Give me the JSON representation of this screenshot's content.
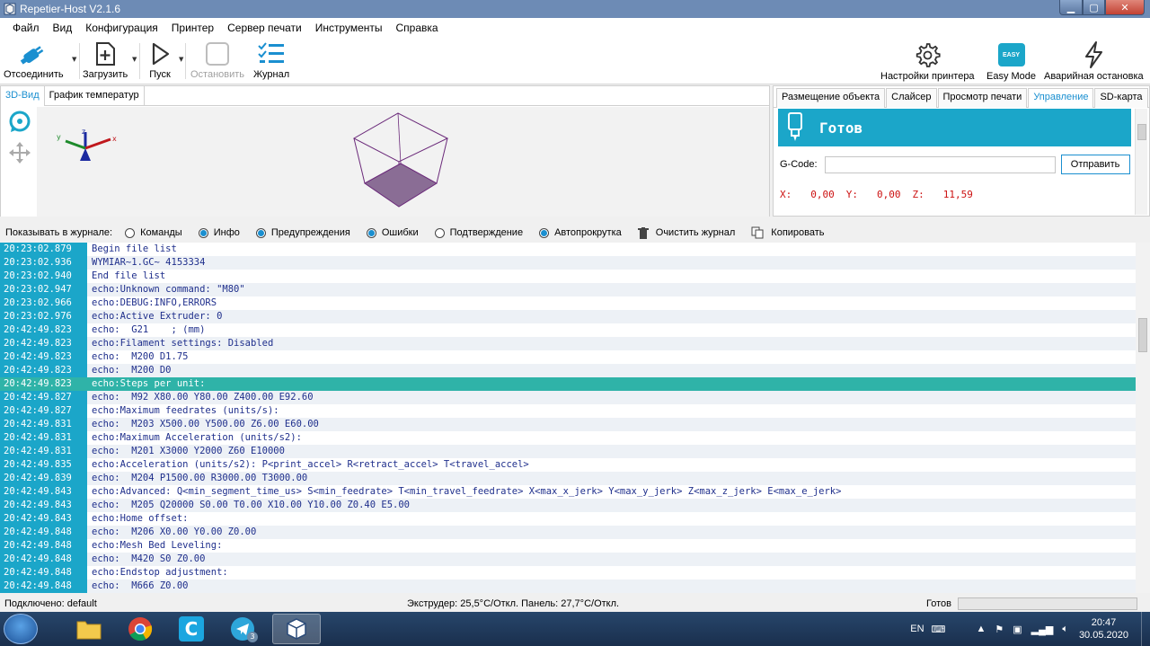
{
  "window": {
    "title": "Repetier-Host V2.1.6"
  },
  "menu": [
    "Файл",
    "Вид",
    "Конфигурация",
    "Принтер",
    "Сервер печати",
    "Инструменты",
    "Справка"
  ],
  "toolbar": {
    "disconnect": "Отсоединить",
    "load": "Загрузить",
    "run": "Пуск",
    "stop": "Остановить",
    "log": "Журнал",
    "printer_settings": "Настройки принтера",
    "easy_mode": "Easy Mode",
    "easy_badge": "EASY",
    "emergency_stop": "Аварийная остановка"
  },
  "viewer_tabs": [
    "3D-Вид",
    "График температур"
  ],
  "right_tabs": [
    "Размещение объекта",
    "Слайсер",
    "Просмотр печати",
    "Управление",
    "SD-карта"
  ],
  "control": {
    "status": "Готов",
    "gcode_label": "G-Code:",
    "gcode_value": "",
    "send_button": "Отправить",
    "coords": {
      "x_label": "X:",
      "x": "0,00",
      "y_label": "Y:",
      "y": "0,00",
      "z_label": "Z:",
      "z": "11,59"
    }
  },
  "log_options": {
    "label": "Показывать в журнале:",
    "commands": "Команды",
    "info": "Инфо",
    "warnings": "Предупреждения",
    "errors": "Ошибки",
    "ack": "Подтверждение",
    "autoscroll": "Автопрокрутка",
    "clear": "Очистить журнал",
    "copy": "Копировать",
    "state": {
      "commands": false,
      "info": true,
      "warnings": true,
      "errors": true,
      "ack": false,
      "autoscroll": true
    }
  },
  "log": [
    {
      "time": "20:23:02.879",
      "msg": "Begin file list"
    },
    {
      "time": "20:23:02.936",
      "msg": "WYMIAR~1.GC~ 4153334"
    },
    {
      "time": "20:23:02.940",
      "msg": "End file list"
    },
    {
      "time": "20:23:02.947",
      "msg": "echo:Unknown command: \"M80\""
    },
    {
      "time": "20:23:02.966",
      "msg": "echo:DEBUG:INFO,ERRORS"
    },
    {
      "time": "20:23:02.976",
      "msg": "echo:Active Extruder: 0"
    },
    {
      "time": "20:42:49.823",
      "msg": "echo:  G21    ; (mm)"
    },
    {
      "time": "20:42:49.823",
      "msg": "echo:Filament settings: Disabled"
    },
    {
      "time": "20:42:49.823",
      "msg": "echo:  M200 D1.75"
    },
    {
      "time": "20:42:49.823",
      "msg": "echo:  M200 D0"
    },
    {
      "time": "20:42:49.823",
      "msg": "echo:Steps per unit:",
      "selected": true
    },
    {
      "time": "20:42:49.827",
      "msg": "echo:  M92 X80.00 Y80.00 Z400.00 E92.60"
    },
    {
      "time": "20:42:49.827",
      "msg": "echo:Maximum feedrates (units/s):"
    },
    {
      "time": "20:42:49.831",
      "msg": "echo:  M203 X500.00 Y500.00 Z6.00 E60.00"
    },
    {
      "time": "20:42:49.831",
      "msg": "echo:Maximum Acceleration (units/s2):"
    },
    {
      "time": "20:42:49.831",
      "msg": "echo:  M201 X3000 Y2000 Z60 E10000"
    },
    {
      "time": "20:42:49.835",
      "msg": "echo:Acceleration (units/s2): P<print_accel> R<retract_accel> T<travel_accel>"
    },
    {
      "time": "20:42:49.839",
      "msg": "echo:  M204 P1500.00 R3000.00 T3000.00"
    },
    {
      "time": "20:42:49.843",
      "msg": "echo:Advanced: Q<min_segment_time_us> S<min_feedrate> T<min_travel_feedrate> X<max_x_jerk> Y<max_y_jerk> Z<max_z_jerk> E<max_e_jerk>"
    },
    {
      "time": "20:42:49.843",
      "msg": "echo:  M205 Q20000 S0.00 T0.00 X10.00 Y10.00 Z0.40 E5.00"
    },
    {
      "time": "20:42:49.843",
      "msg": "echo:Home offset:"
    },
    {
      "time": "20:42:49.848",
      "msg": "echo:  M206 X0.00 Y0.00 Z0.00"
    },
    {
      "time": "20:42:49.848",
      "msg": "echo:Mesh Bed Leveling:"
    },
    {
      "time": "20:42:49.848",
      "msg": "echo:  M420 S0 Z0.00"
    },
    {
      "time": "20:42:49.848",
      "msg": "echo:Endstop adjustment:"
    },
    {
      "time": "20:42:49.848",
      "msg": "echo:  M666 Z0.00"
    }
  ],
  "statusbar": {
    "connected": "Подключено: default",
    "temps": "Экструдер: 25,5°C/Откл. Панель: 27,7°C/Откл.",
    "state": "Готов"
  },
  "taskbar": {
    "lang": "EN",
    "time": "20:47",
    "date": "30.05.2020",
    "telegram_badge": "3"
  },
  "colors": {
    "accent": "#1ba6c9",
    "selected_row": "#2fb3a8",
    "coords": "#cc1111"
  }
}
